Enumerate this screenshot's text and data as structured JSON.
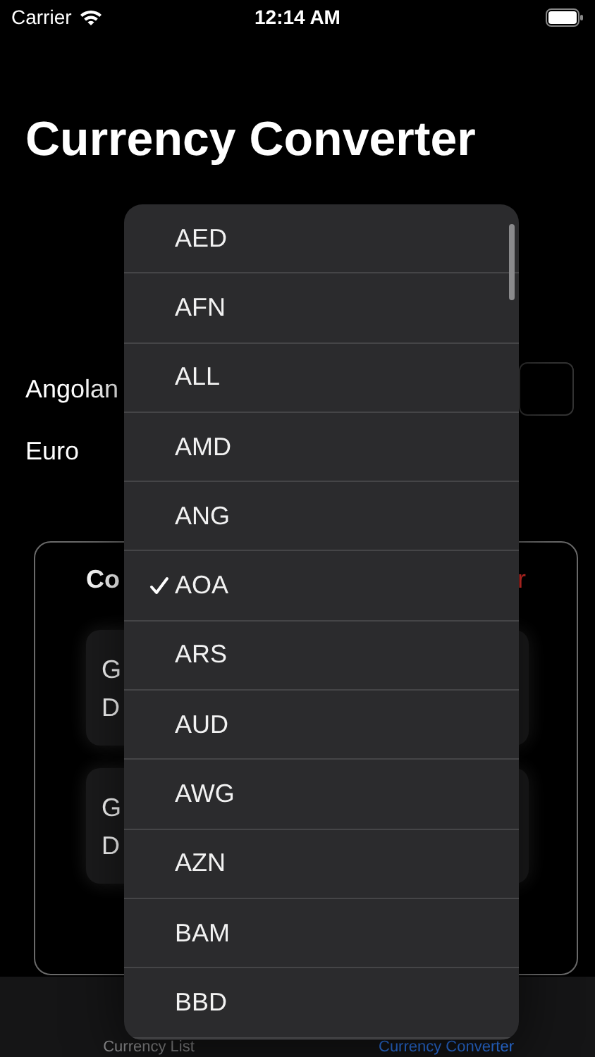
{
  "status_bar": {
    "carrier": "Carrier",
    "time": "12:14 AM"
  },
  "title": "Currency Converter",
  "rows": [
    {
      "label": "Angolan",
      "kind": "field"
    },
    {
      "label": "Euro",
      "kind": "text"
    }
  ],
  "card": {
    "title": "Co",
    "action": "r",
    "items": [
      {
        "line_1": "G",
        "line_2": "D"
      },
      {
        "line_1": "G",
        "line_2": "D"
      }
    ]
  },
  "menu": {
    "items": [
      {
        "label": "AED",
        "selected": false
      },
      {
        "label": "AFN",
        "selected": false
      },
      {
        "label": "ALL",
        "selected": false
      },
      {
        "label": "AMD",
        "selected": false
      },
      {
        "label": "ANG",
        "selected": false
      },
      {
        "label": "AOA",
        "selected": true
      },
      {
        "label": "ARS",
        "selected": false
      },
      {
        "label": "AUD",
        "selected": false
      },
      {
        "label": "AWG",
        "selected": false
      },
      {
        "label": "AZN",
        "selected": false
      },
      {
        "label": "BAM",
        "selected": false
      },
      {
        "label": "BBD",
        "selected": false
      }
    ]
  },
  "tabs": [
    {
      "label": "Currency List",
      "selected": false
    },
    {
      "label": "Currency Converter",
      "selected": true
    }
  ]
}
